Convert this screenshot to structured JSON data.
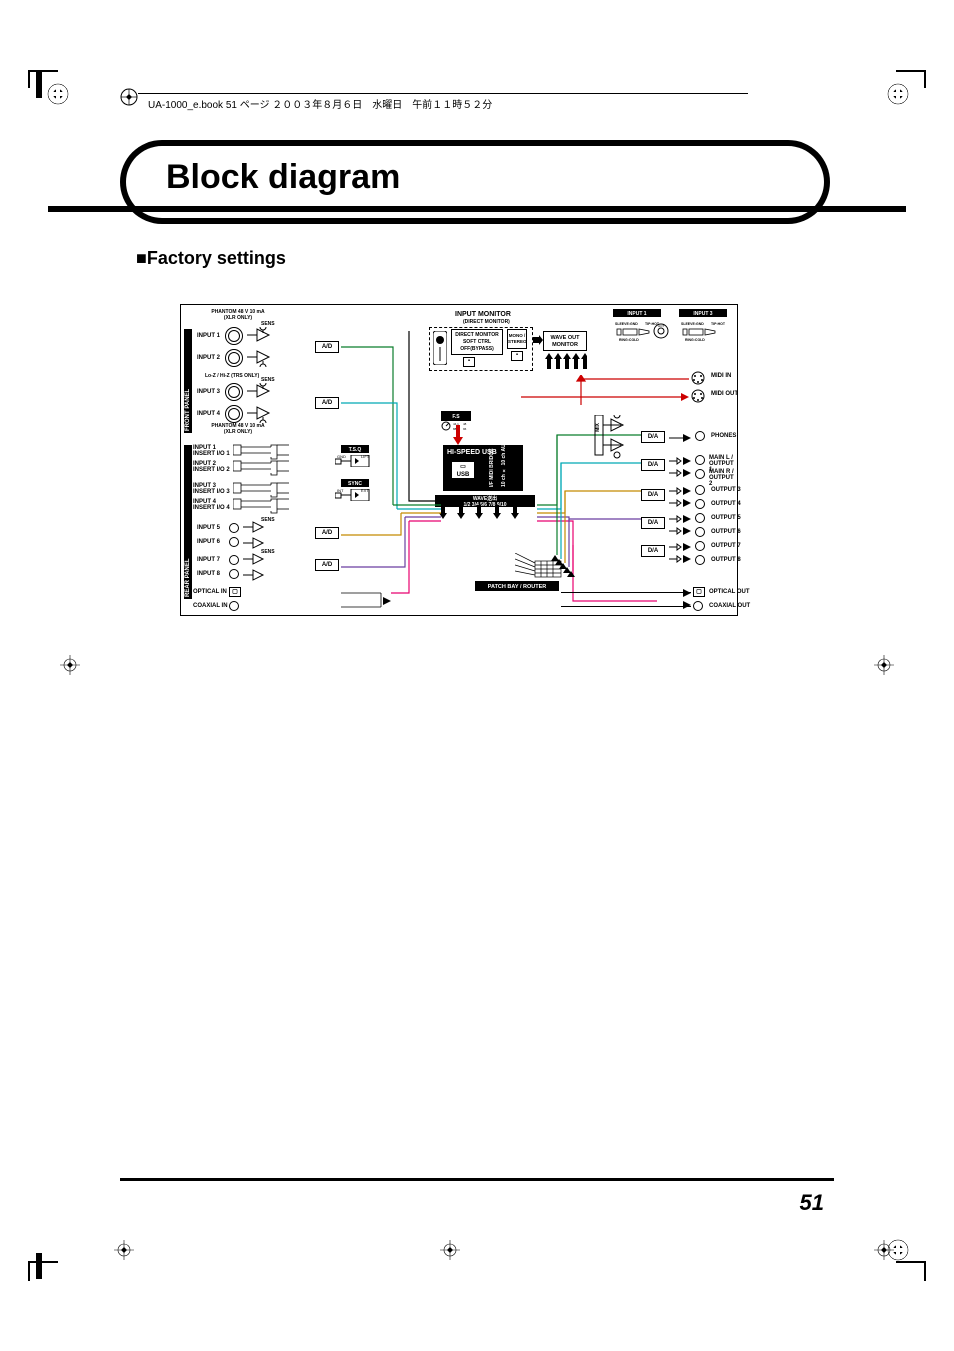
{
  "slug": "UA-1000_e.book  51 ページ  ２００３年８月６日　水曜日　午前１１時５２分",
  "title": "Block diagram",
  "section_heading": "■Factory settings",
  "page_number": "51",
  "diagram": {
    "top_labels": {
      "input_monitor": "INPUT MONITOR",
      "input_monitor_sub": "(DIRECT MONITOR)",
      "direct_monitor_soft_ctrl": "DIRECT MONITOR\nSOFT CTRL\nOFF(BYPASS)",
      "mono_stereo": "MONO / STEREO",
      "wave_out_monitor": "WAVE OUT\nMONITOR",
      "input1_plug": "INPUT 1",
      "input3_plug": "INPUT 3",
      "input1_plug_sub": "SLEEVE:GND  TIP:HOT  RING:COLD",
      "input3_plug_sub": "SLEEVE:GND  TIP:HOT  RING:COLD",
      "phantom12": "PHANTOM 48 V 10 mA\n(XLR ONLY)",
      "phantom34": "PHANTOM 48 V 10 mA\n(XLR ONLY)",
      "lo_z": "Lo-Z / Hi-Z (TRS ONLY)"
    },
    "left_column": {
      "front_panel": "FRONT PANEL",
      "rear_panel": "REAR PANEL",
      "inputs": [
        "INPUT 1",
        "INPUT 2",
        "INPUT 3",
        "INPUT 4",
        "INPUT 1\nINSERT I/O 1",
        "INPUT 2\nINSERT I/O 2",
        "INPUT 3\nINSERT I/O 3",
        "INPUT 4\nINSERT I/O 4",
        "INPUT 5",
        "INPUT 6",
        "INPUT 7",
        "INPUT 8",
        "OPTICAL IN",
        "COAXIAL IN"
      ],
      "sens": "SENS",
      "ad": "A/D"
    },
    "center": {
      "tsq": "T.S.Q",
      "gnd_lift": "GND  LIFT",
      "sync": "INT  EXT",
      "sync_label": "SYNC",
      "fs": "F.S",
      "hi_speed_usb": "HI-SPEED USB",
      "usb_sub": "USB",
      "midi_bridge": "I/F MIDI BRIDGE",
      "wave_send": "WAVE送出\n1/2 3/4 5/6 7/8 9/10",
      "patch_bay": "PATCH BAY / ROUTER"
    },
    "right_column": {
      "da": "D/A",
      "mix": "MIX",
      "outputs": [
        "MIDI IN",
        "MIDI OUT",
        "PHONES",
        "MAIN L /\nOUTPUT 1",
        "MAIN R /\nOUTPUT 2",
        "OUTPUT 3",
        "OUTPUT 4",
        "OUTPUT 5",
        "OUTPUT 6",
        "OUTPUT 7",
        "OUTPUT 8",
        "OPTICAL OUT",
        "COAXIAL OUT"
      ]
    }
  }
}
